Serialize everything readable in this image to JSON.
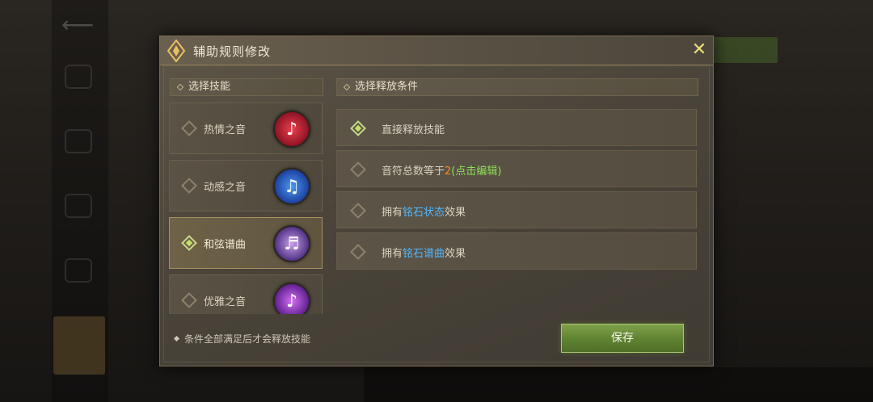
{
  "dialog": {
    "title": "辅助规则修改",
    "close_icon": "close-icon"
  },
  "skills": {
    "header": "选择技能",
    "items": [
      {
        "label": "热情之音",
        "selected": false,
        "icon": "music-note-red-icon",
        "color": "#c8283a"
      },
      {
        "label": "动感之音",
        "selected": false,
        "icon": "music-note-blue-icon",
        "color": "#2a66d8"
      },
      {
        "label": "和弦谱曲",
        "selected": true,
        "icon": "harp-purple-icon",
        "color": "#7a4ab0"
      },
      {
        "label": "优雅之音",
        "selected": false,
        "icon": "music-note-purple-icon",
        "color": "#9a38c8"
      }
    ]
  },
  "conditions": {
    "header": "选择释放条件",
    "items": [
      {
        "prefix": "直接释放技能",
        "selected": true
      },
      {
        "prefix": "音符总数等于",
        "number": "2",
        "link": "(点击编辑)",
        "selected": false
      },
      {
        "prefix": "拥有",
        "link": "铭石状态",
        "suffix": "效果",
        "selected": false
      },
      {
        "prefix": "拥有",
        "link": "铭石谱曲",
        "suffix": "效果",
        "selected": false
      }
    ]
  },
  "footer": {
    "note": "条件全部满足后才会释放技能",
    "save_label": "保存"
  },
  "colors": {
    "accent_green": "#8fe05a",
    "accent_blue": "#4fb8ff",
    "accent_orange": "#ff8a2b"
  }
}
